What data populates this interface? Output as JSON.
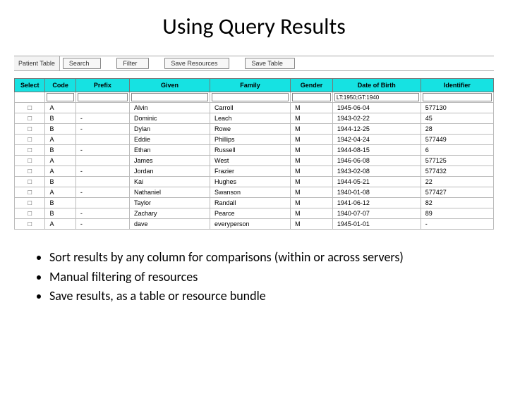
{
  "title": "Using Query Results",
  "toolbar": {
    "label": "Patient Table",
    "search": "Search",
    "filter": "Filter",
    "save_resources": "Save Resources",
    "save_table": "Save Table"
  },
  "columns": [
    "Select",
    "Code",
    "Prefix",
    "Given",
    "Family",
    "Gender",
    "Date of Birth",
    "Identifier"
  ],
  "filter_dob": "LT:1950;GT:1940",
  "rows": [
    {
      "sel": "☐",
      "code": "A",
      "prefix": "",
      "given": "Alvin",
      "family": "Carroll",
      "gender": "M",
      "dob": "1945-06-04",
      "ident": "577130"
    },
    {
      "sel": "☐",
      "code": "B",
      "prefix": "-",
      "given": "Dominic",
      "family": "Leach",
      "gender": "M",
      "dob": "1943-02-22",
      "ident": "45"
    },
    {
      "sel": "☐",
      "code": "B",
      "prefix": "-",
      "given": "Dylan",
      "family": "Rowe",
      "gender": "M",
      "dob": "1944-12-25",
      "ident": "28"
    },
    {
      "sel": "☐",
      "code": "A",
      "prefix": "",
      "given": "Eddie",
      "family": "Phillips",
      "gender": "M",
      "dob": "1942-04-24",
      "ident": "577449"
    },
    {
      "sel": "☐",
      "code": "B",
      "prefix": "-",
      "given": "Ethan",
      "family": "Russell",
      "gender": "M",
      "dob": "1944-08-15",
      "ident": "6"
    },
    {
      "sel": "☐",
      "code": "A",
      "prefix": "",
      "given": "James",
      "family": "West",
      "gender": "M",
      "dob": "1946-06-08",
      "ident": "577125"
    },
    {
      "sel": "☐",
      "code": "A",
      "prefix": "-",
      "given": "Jordan",
      "family": "Frazier",
      "gender": "M",
      "dob": "1943-02-08",
      "ident": "577432"
    },
    {
      "sel": "☐",
      "code": "B",
      "prefix": "",
      "given": "Kai",
      "family": "Hughes",
      "gender": "M",
      "dob": "1944-05-21",
      "ident": "22"
    },
    {
      "sel": "☐",
      "code": "A",
      "prefix": "-",
      "given": "Nathaniel",
      "family": "Swanson",
      "gender": "M",
      "dob": "1940-01-08",
      "ident": "577427"
    },
    {
      "sel": "☐",
      "code": "B",
      "prefix": "",
      "given": "Taylor",
      "family": "Randall",
      "gender": "M",
      "dob": "1941-06-12",
      "ident": "82"
    },
    {
      "sel": "☐",
      "code": "B",
      "prefix": "-",
      "given": "Zachary",
      "family": "Pearce",
      "gender": "M",
      "dob": "1940-07-07",
      "ident": "89"
    },
    {
      "sel": "☐",
      "code": "A",
      "prefix": "-",
      "given": "dave",
      "family": "everyperson",
      "gender": "M",
      "dob": "1945-01-01",
      "ident": "-"
    }
  ],
  "bullets": [
    "Sort results by any column for comparisons (within or across servers)",
    "Manual filtering of resources",
    "Save results, as a table or resource bundle"
  ]
}
